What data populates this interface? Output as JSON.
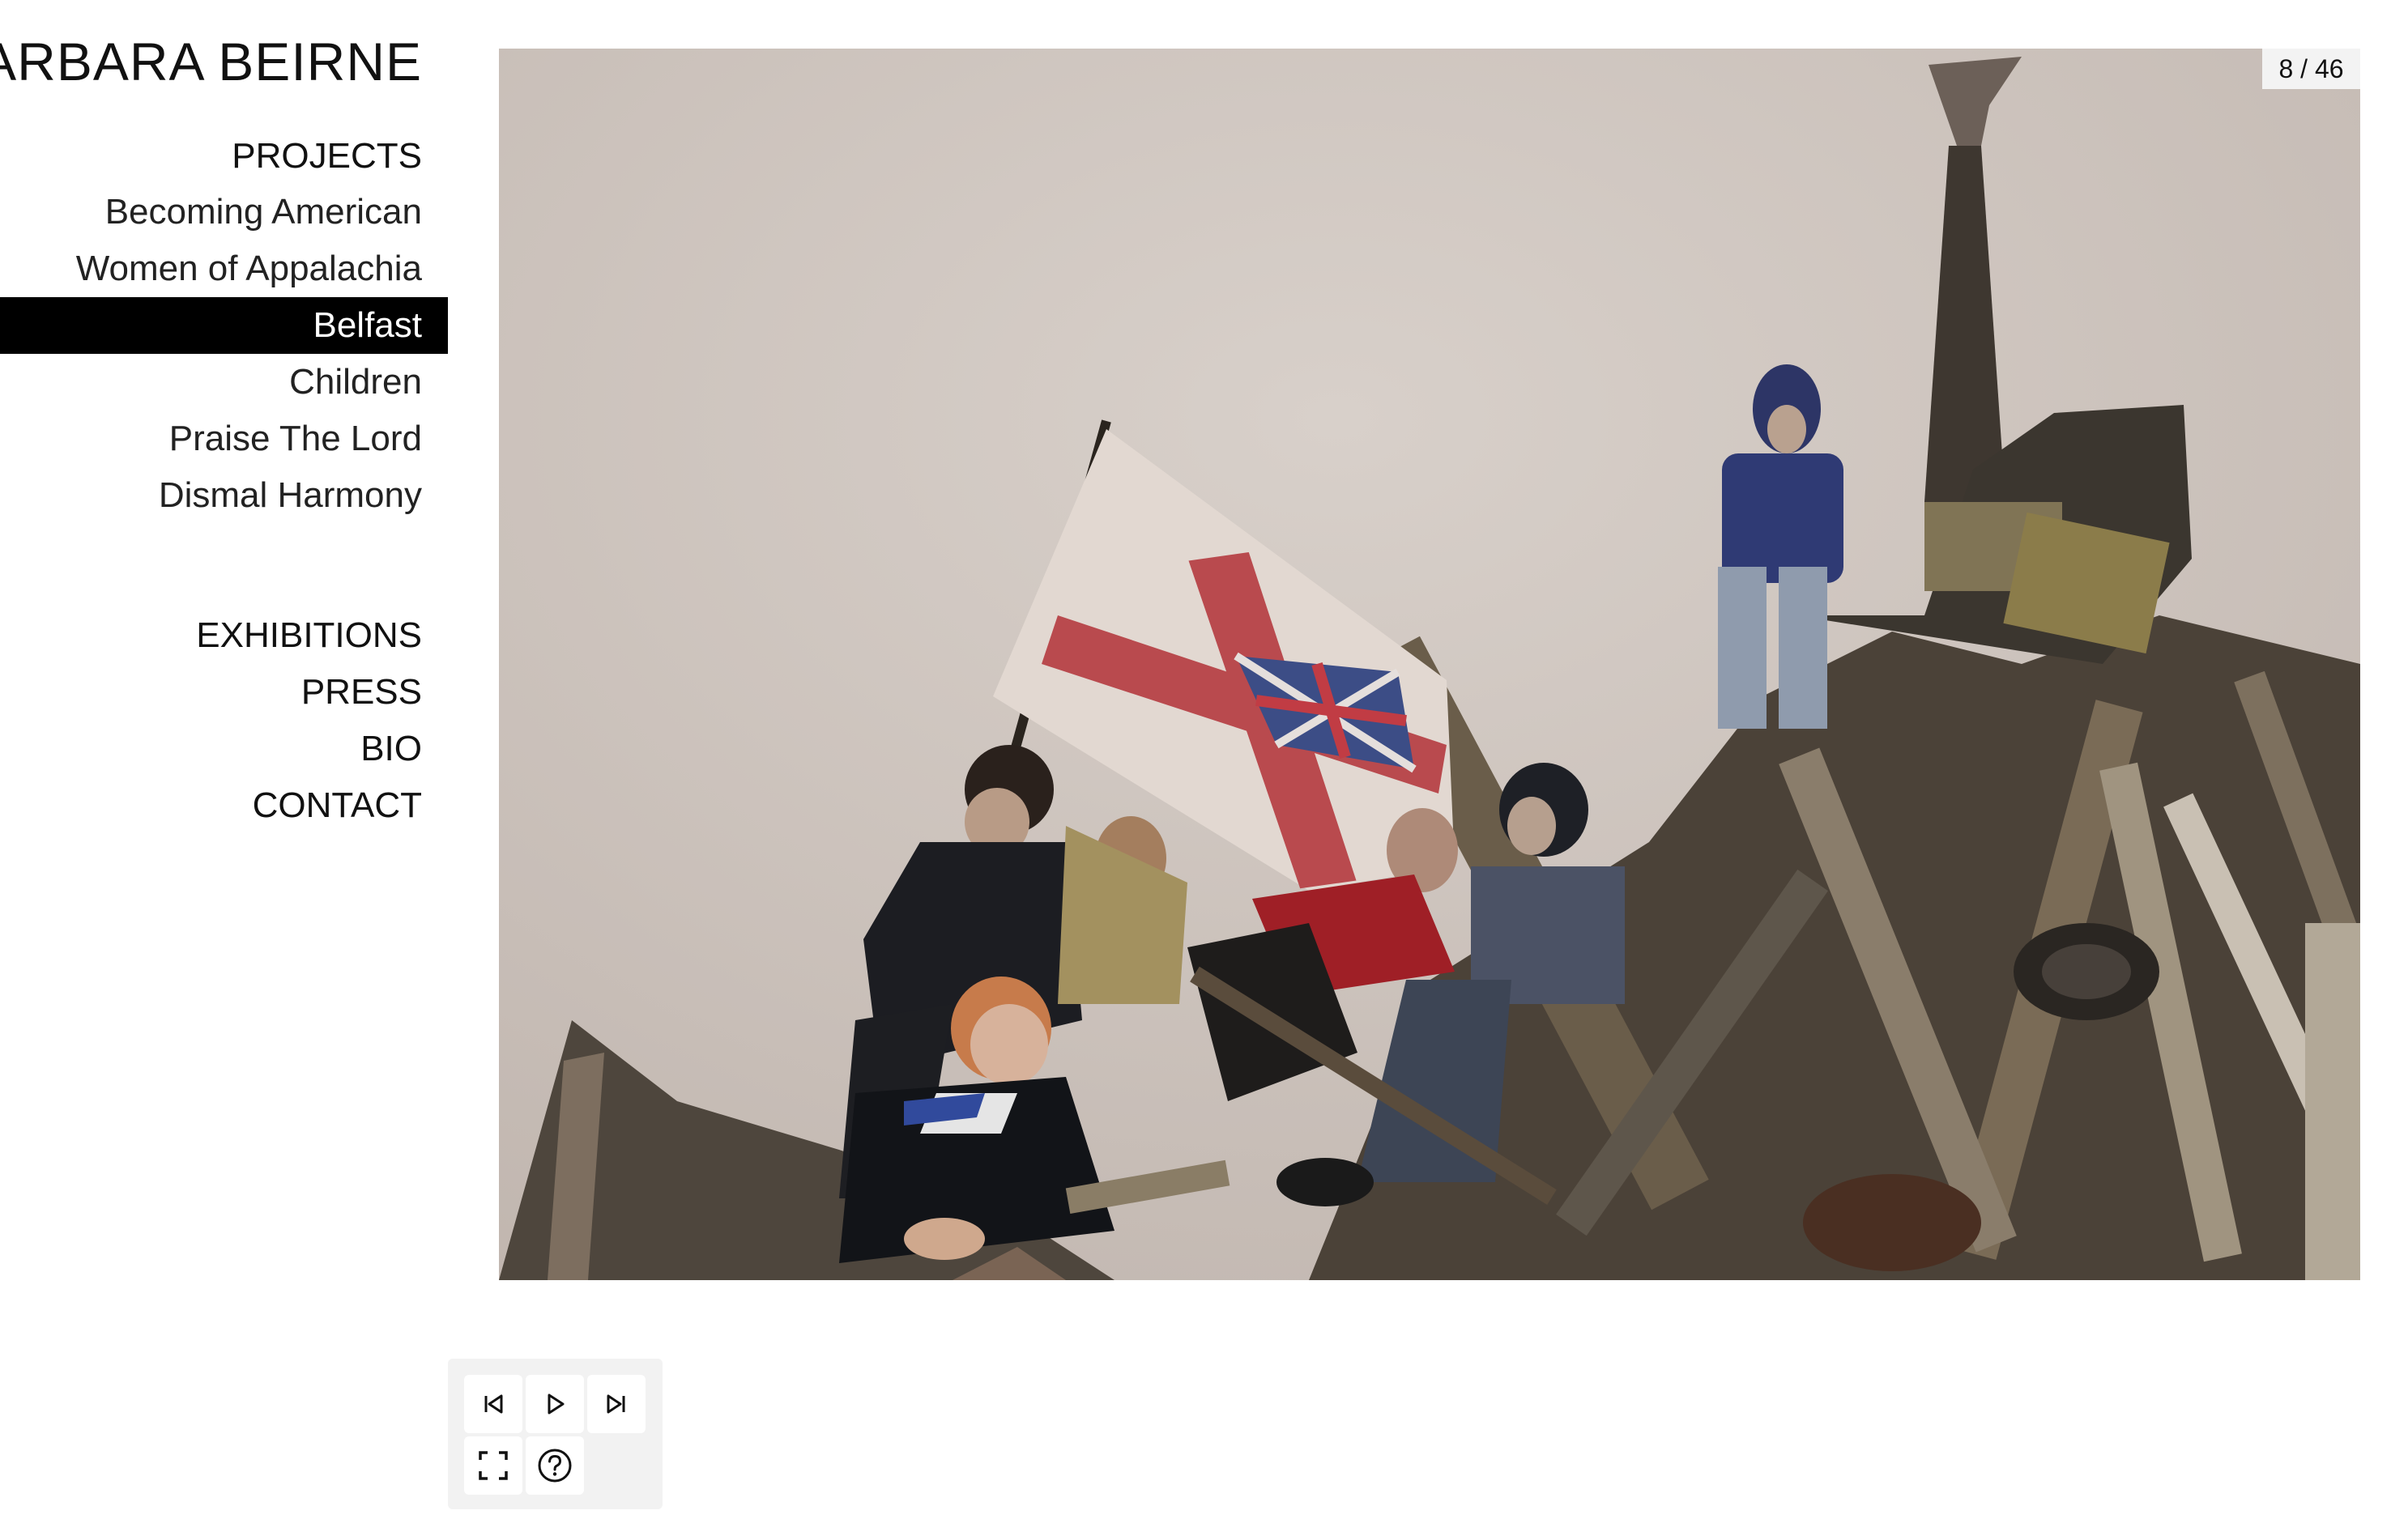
{
  "site": {
    "title": "BARBARA BEIRNE"
  },
  "nav": {
    "projects_heading": "PROJECTS",
    "projects": [
      {
        "label": "Becoming American"
      },
      {
        "label": "Women of Appalachia"
      },
      {
        "label": "Belfast",
        "active": true
      },
      {
        "label": "Children"
      },
      {
        "label": "Praise The Lord"
      },
      {
        "label": "Dismal Harmony"
      }
    ],
    "pages": [
      {
        "label": "EXHIBITIONS"
      },
      {
        "label": "PRESS"
      },
      {
        "label": "BIO"
      },
      {
        "label": "CONTACT"
      }
    ]
  },
  "slideshow": {
    "counter": "8 / 46",
    "image_alt": "",
    "controls": {
      "previous": "skip-previous-icon",
      "play": "play-icon",
      "next": "skip-next-icon",
      "fullscreen": "fullscreen-icon",
      "help": "help-icon"
    }
  },
  "colors": {
    "active_bg": "#000000",
    "active_text": "#ffffff",
    "text": "#111111",
    "controls_bg": "#f2f2f2",
    "photo_sky": "#d3ccc6"
  }
}
